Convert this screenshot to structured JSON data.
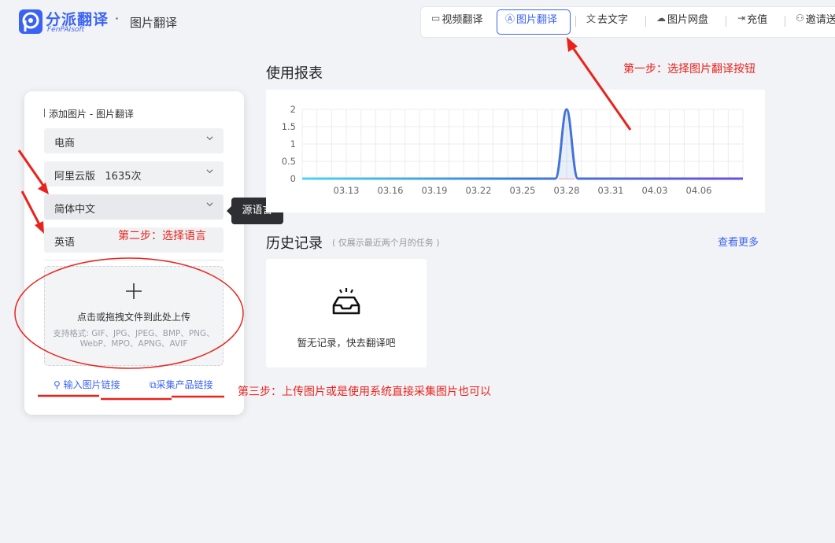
{
  "brand": {
    "name": "分派翻译",
    "sub": "FenPAIsoft",
    "dot": "·",
    "page_title": "图片翻译",
    "color": "#3a63f3"
  },
  "nav": [
    {
      "icon": "video-icon",
      "glyph": "▭",
      "label": "视频翻译"
    },
    {
      "icon": "image-translate-icon",
      "glyph": "Ⓐ",
      "label": "图片翻译",
      "active": true
    },
    {
      "icon": "remove-text-icon",
      "glyph": "文",
      "label": "去文字"
    },
    {
      "icon": "cloud-icon",
      "glyph": "☁",
      "label": "图片网盘"
    },
    {
      "icon": "recharge-icon",
      "glyph": "⇥",
      "label": "充值"
    },
    {
      "icon": "invite-icon",
      "glyph": "⚇",
      "label": "邀请送"
    }
  ],
  "panel": {
    "title": "添加图片 - 图片翻译",
    "selects": [
      {
        "name": "category-select",
        "label": "电商"
      },
      {
        "name": "engine-select",
        "label": "阿里云版   1635次"
      },
      {
        "name": "source-language-select",
        "label": "简体中文"
      },
      {
        "name": "target-language-select",
        "label": "英语"
      }
    ],
    "upload_main": "点击或拖拽文件到此处上传",
    "upload_formats": "支持格式: GIF、JPG、JPEG、BMP、PNG、WebP、MPO、APNG、AVIF",
    "link_image_url": "输入图片链接",
    "link_collect": "采集产品链接",
    "tooltip": "源语言"
  },
  "usage": {
    "title": "使用报表"
  },
  "history": {
    "title": "历史记录",
    "subtitle": "( 仅展示最近两个月的任务 )",
    "more": "查看更多",
    "empty": "暂无记录，快去翻译吧"
  },
  "chart_data": {
    "type": "line",
    "x_ticks": [
      "03.13",
      "03.16",
      "03.19",
      "03.22",
      "03.25",
      "03.28",
      "03.31",
      "04.03",
      "04.06"
    ],
    "y_ticks": [
      "2",
      "1.5",
      "1",
      "0.5",
      "0"
    ],
    "ylim": [
      0,
      2
    ],
    "grid": true,
    "series": [
      {
        "x": [
          "03.28"
        ],
        "values": [
          2
        ],
        "color": "#3a7bd5"
      }
    ]
  },
  "annotations": {
    "step1": "第一步：选择图片翻译按钮",
    "step2": "第二步：选择语言",
    "step3": "第三步：上传图片或是使用系统直接采集图片也可以",
    "color": "#e8231c"
  }
}
